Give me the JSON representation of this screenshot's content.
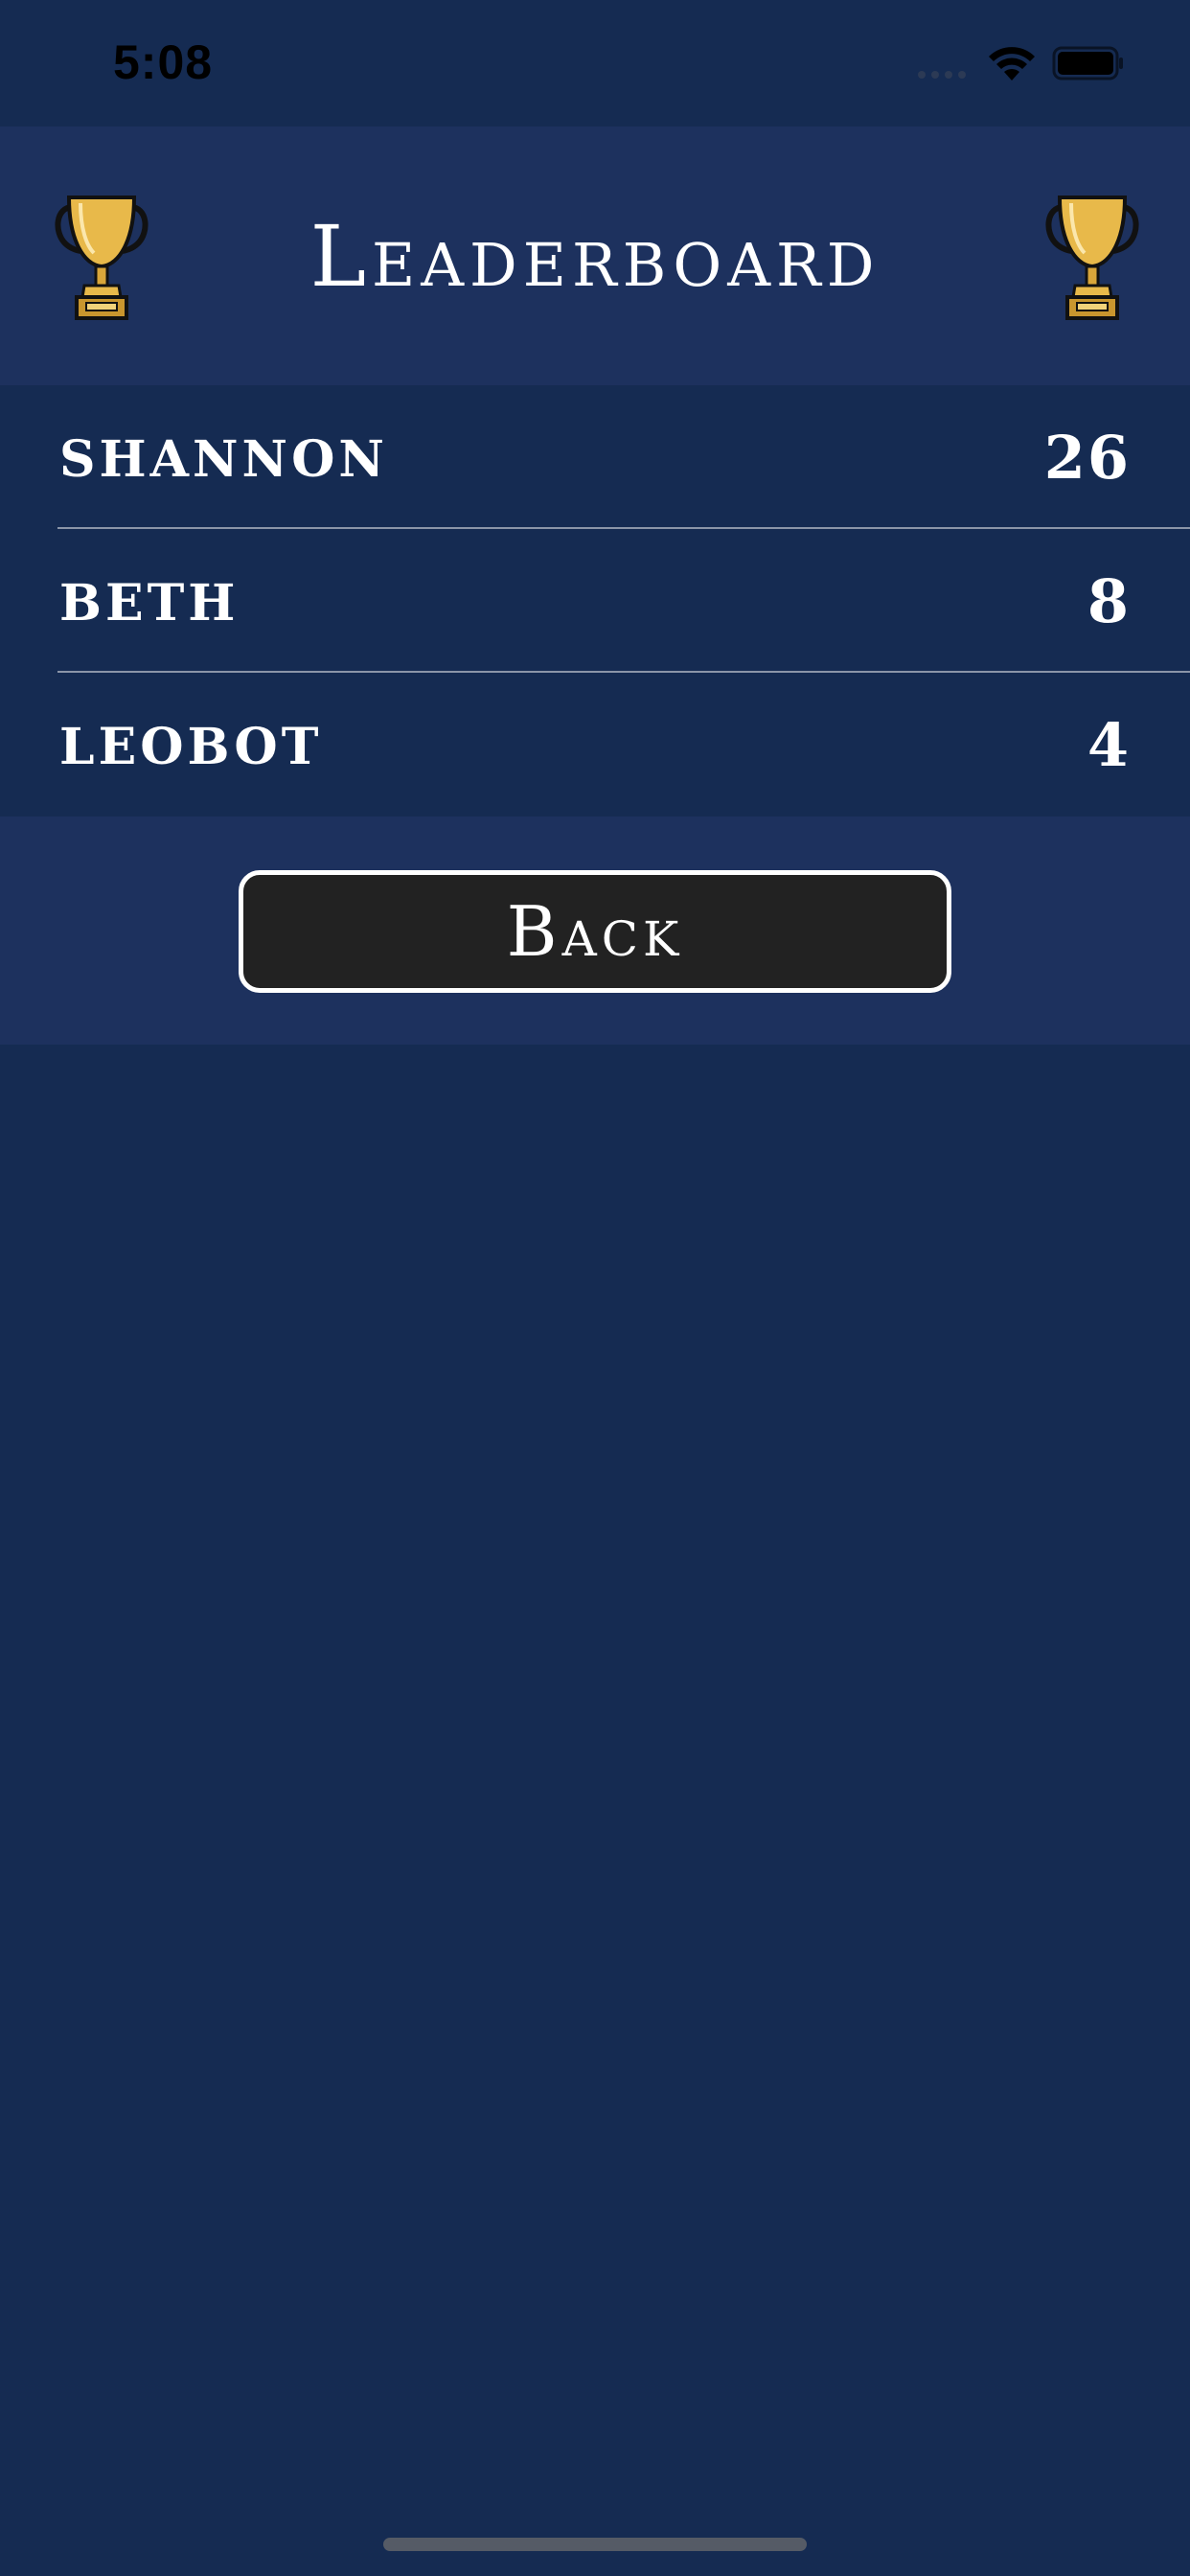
{
  "status_bar": {
    "time": "5:08",
    "icons": [
      "signal-dots-icon",
      "wifi-icon",
      "battery-icon"
    ]
  },
  "header": {
    "title": "Leaderboard",
    "left_icon": "trophy-icon",
    "right_icon": "trophy-icon"
  },
  "leaderboard": {
    "entries": [
      {
        "name": "SHANNON",
        "score": "26"
      },
      {
        "name": "BETH",
        "score": "8"
      },
      {
        "name": "LEOBOT",
        "score": "4"
      }
    ]
  },
  "back_button": {
    "label": "Back"
  },
  "colors": {
    "background": "#152b52",
    "header_background": "#1d315e",
    "button_background": "#222222",
    "trophy_gold": "#e8b94a",
    "text": "#ffffff"
  }
}
